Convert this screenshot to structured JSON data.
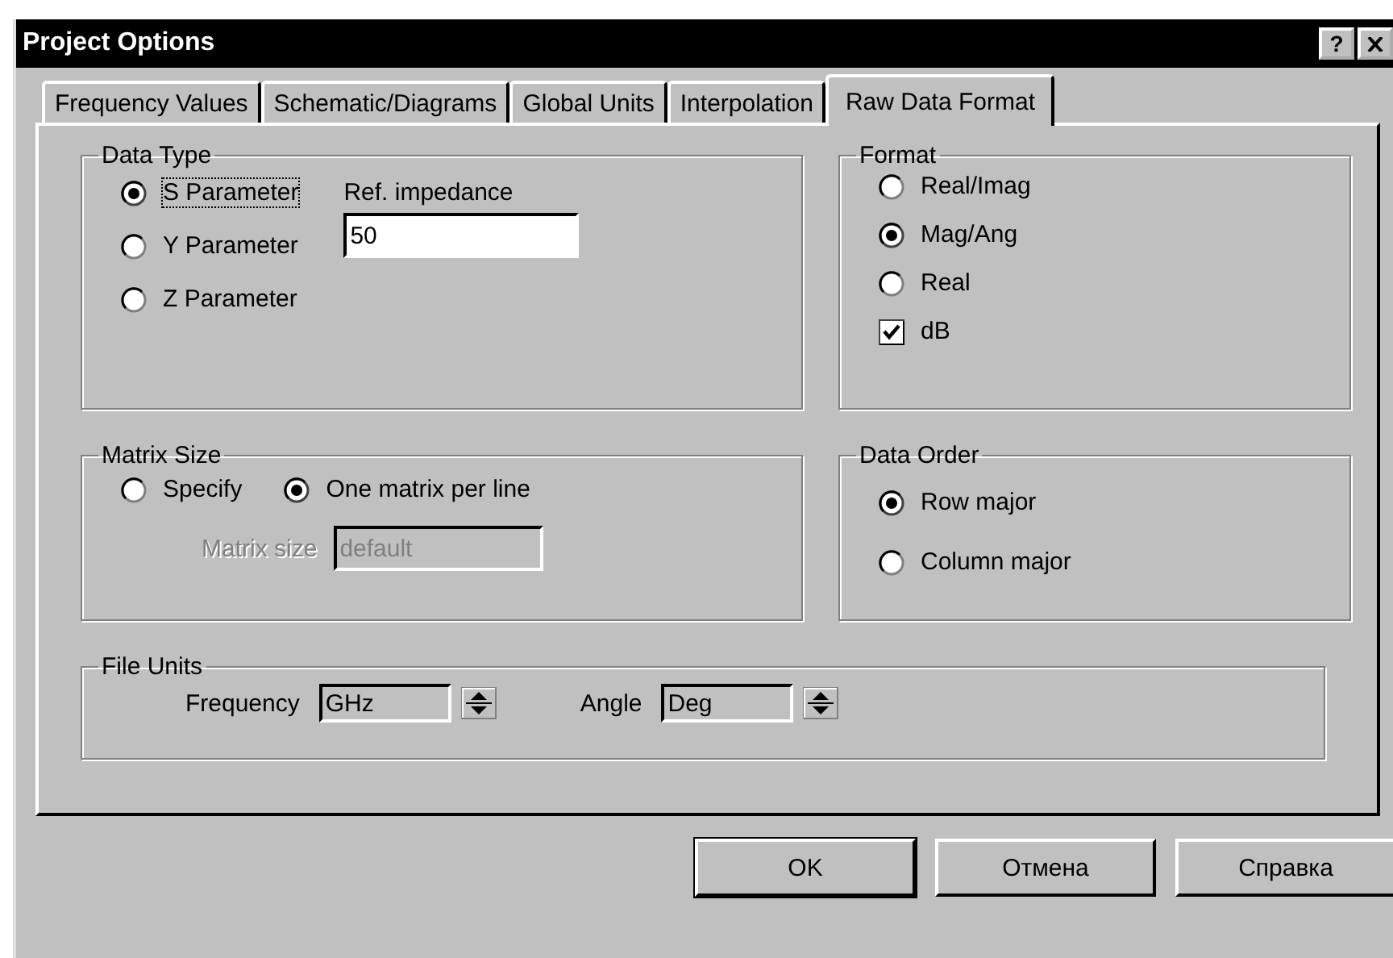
{
  "window": {
    "title": "Project Options",
    "help": "?"
  },
  "tabs": [
    {
      "label": "Frequency Values",
      "selected": false
    },
    {
      "label": "Schematic/Diagrams",
      "selected": false
    },
    {
      "label": "Global Units",
      "selected": false
    },
    {
      "label": "Interpolation",
      "selected": false
    },
    {
      "label": "Raw Data Format",
      "selected": true
    }
  ],
  "data_type": {
    "label": "Data Type",
    "options": [
      {
        "label": "S Parameter",
        "selected": true
      },
      {
        "label": "Y Parameter",
        "selected": false
      },
      {
        "label": "Z Parameter",
        "selected": false
      }
    ],
    "ref_impedance": {
      "label": "Ref. impedance",
      "value": "50"
    }
  },
  "format": {
    "label": "Format",
    "options": [
      {
        "kind": "radio",
        "label": "Real/Imag",
        "selected": false
      },
      {
        "kind": "radio",
        "label": "Mag/Ang",
        "selected": true
      },
      {
        "kind": "radio",
        "label": "Real",
        "selected": false
      },
      {
        "kind": "checkbox",
        "label": "dB",
        "checked": true
      }
    ]
  },
  "matrix_size": {
    "label": "Matrix Size",
    "options": [
      {
        "label": "Specify",
        "selected": false
      },
      {
        "label": "One matrix per line",
        "selected": true
      }
    ],
    "size_field": {
      "label": "Matrix size",
      "value": "default",
      "disabled": true
    }
  },
  "data_order": {
    "label": "Data Order",
    "options": [
      {
        "label": "Row major",
        "selected": true
      },
      {
        "label": "Column major",
        "selected": false
      }
    ]
  },
  "file_units": {
    "label": "File Units",
    "fields": [
      {
        "label": "Frequency",
        "value": "GHz"
      },
      {
        "label": "Angle",
        "value": "Deg"
      }
    ]
  },
  "buttons": [
    "OK",
    "Отмена",
    "Справка"
  ]
}
